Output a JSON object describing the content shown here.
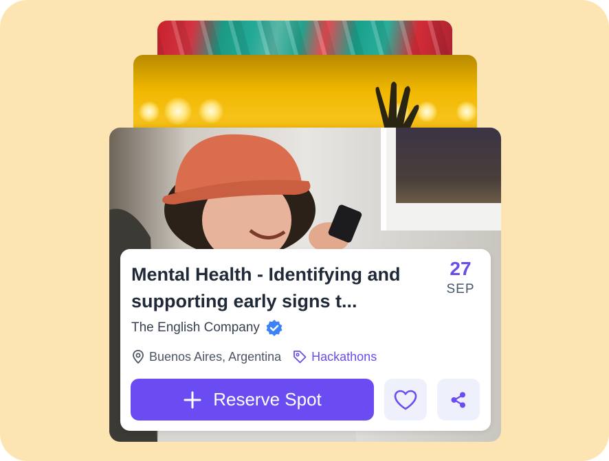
{
  "event": {
    "title": "Mental Health - Identifying and supporting early signs t...",
    "date_day": "27",
    "date_month": "SEP",
    "organizer": "The English Company",
    "location": "Buenos Aires, Argentina",
    "category": "Hackathons",
    "reserve_label": "Reserve Spot"
  },
  "colors": {
    "background": "#fde4b3",
    "accent": "#6a4cf2",
    "verified": "#3b82f6",
    "icon_button_bg": "#eef0fb"
  },
  "icons": [
    "verified-badge-icon",
    "location-pin-icon",
    "tag-icon",
    "plus-icon",
    "heart-icon",
    "share-icon"
  ]
}
